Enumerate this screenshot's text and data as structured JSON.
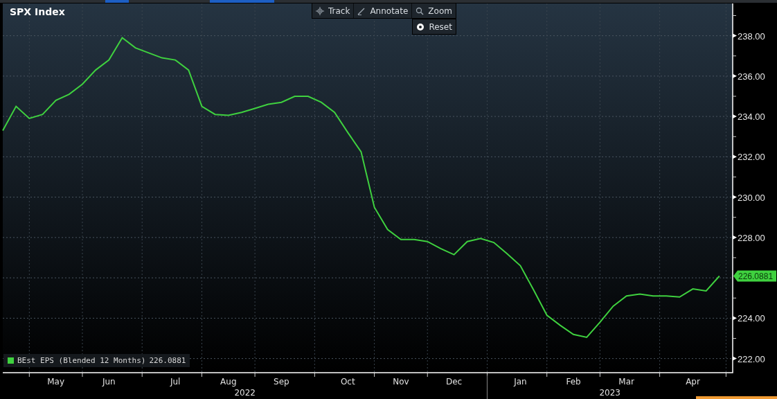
{
  "toolbar": [
    {
      "label": "Track",
      "kind": "crosshair"
    },
    {
      "label": "Annotate",
      "kind": "pen"
    },
    {
      "label": "Zoom",
      "kind": "search"
    }
  ],
  "reset_button": {
    "label": "Reset",
    "kind": "radio"
  },
  "chart": {
    "legend_value": "226.0881",
    "last_value_flag": "226.0881",
    "year_labels": [
      {
        "label": "2022"
      },
      {
        "label": "2023"
      }
    ],
    "chart_data": {
      "type": "line",
      "title": "SPX Index",
      "grid": true,
      "categories": [
        null,
        null,
        null,
        null,
        "May",
        null,
        null,
        null,
        "Jun",
        null,
        null,
        null,
        null,
        "Jul",
        null,
        null,
        null,
        "Aug",
        null,
        null,
        null,
        "Sep",
        null,
        null,
        null,
        null,
        "Oct",
        null,
        null,
        null,
        "Nov",
        null,
        null,
        null,
        "Dec",
        null,
        null,
        null,
        null,
        "Jan",
        null,
        null,
        null,
        "Feb",
        null,
        null,
        null,
        "Mar",
        null,
        null,
        null,
        null,
        "Apr",
        null,
        null
      ],
      "series": [
        {
          "name": "BEst EPS (Blended 12 Months)",
          "color": "#3fd13f",
          "values": [
            233.3,
            234.5,
            233.9,
            234.1,
            234.8,
            235.1,
            235.6,
            236.3,
            236.8,
            237.9,
            237.4,
            237.15,
            236.9,
            236.8,
            236.3,
            234.5,
            234.1,
            234.05,
            234.2,
            234.4,
            234.6,
            234.7,
            235.0,
            235.0,
            234.7,
            234.2,
            233.2,
            232.25,
            229.5,
            228.4,
            227.9,
            227.9,
            227.8,
            227.45,
            227.15,
            227.8,
            227.95,
            227.75,
            227.2,
            226.6,
            225.4,
            224.15,
            223.65,
            223.2,
            223.05,
            223.8,
            224.6,
            225.1,
            225.2,
            225.1,
            225.1,
            225.05,
            225.45,
            225.35,
            226.09
          ]
        }
      ],
      "ylim": [
        221.3,
        239.6
      ],
      "yticks": [
        {
          "value": 222,
          "label": "222.00"
        },
        {
          "value": 224,
          "label": "224.00"
        },
        {
          "value": 228,
          "label": "228.00"
        },
        {
          "value": 230,
          "label": "230.00"
        },
        {
          "value": 232,
          "label": "232.00"
        },
        {
          "value": 234,
          "label": "234.00"
        },
        {
          "value": 236,
          "label": "236.00"
        },
        {
          "value": 238,
          "label": "238.00"
        }
      ]
    }
  }
}
